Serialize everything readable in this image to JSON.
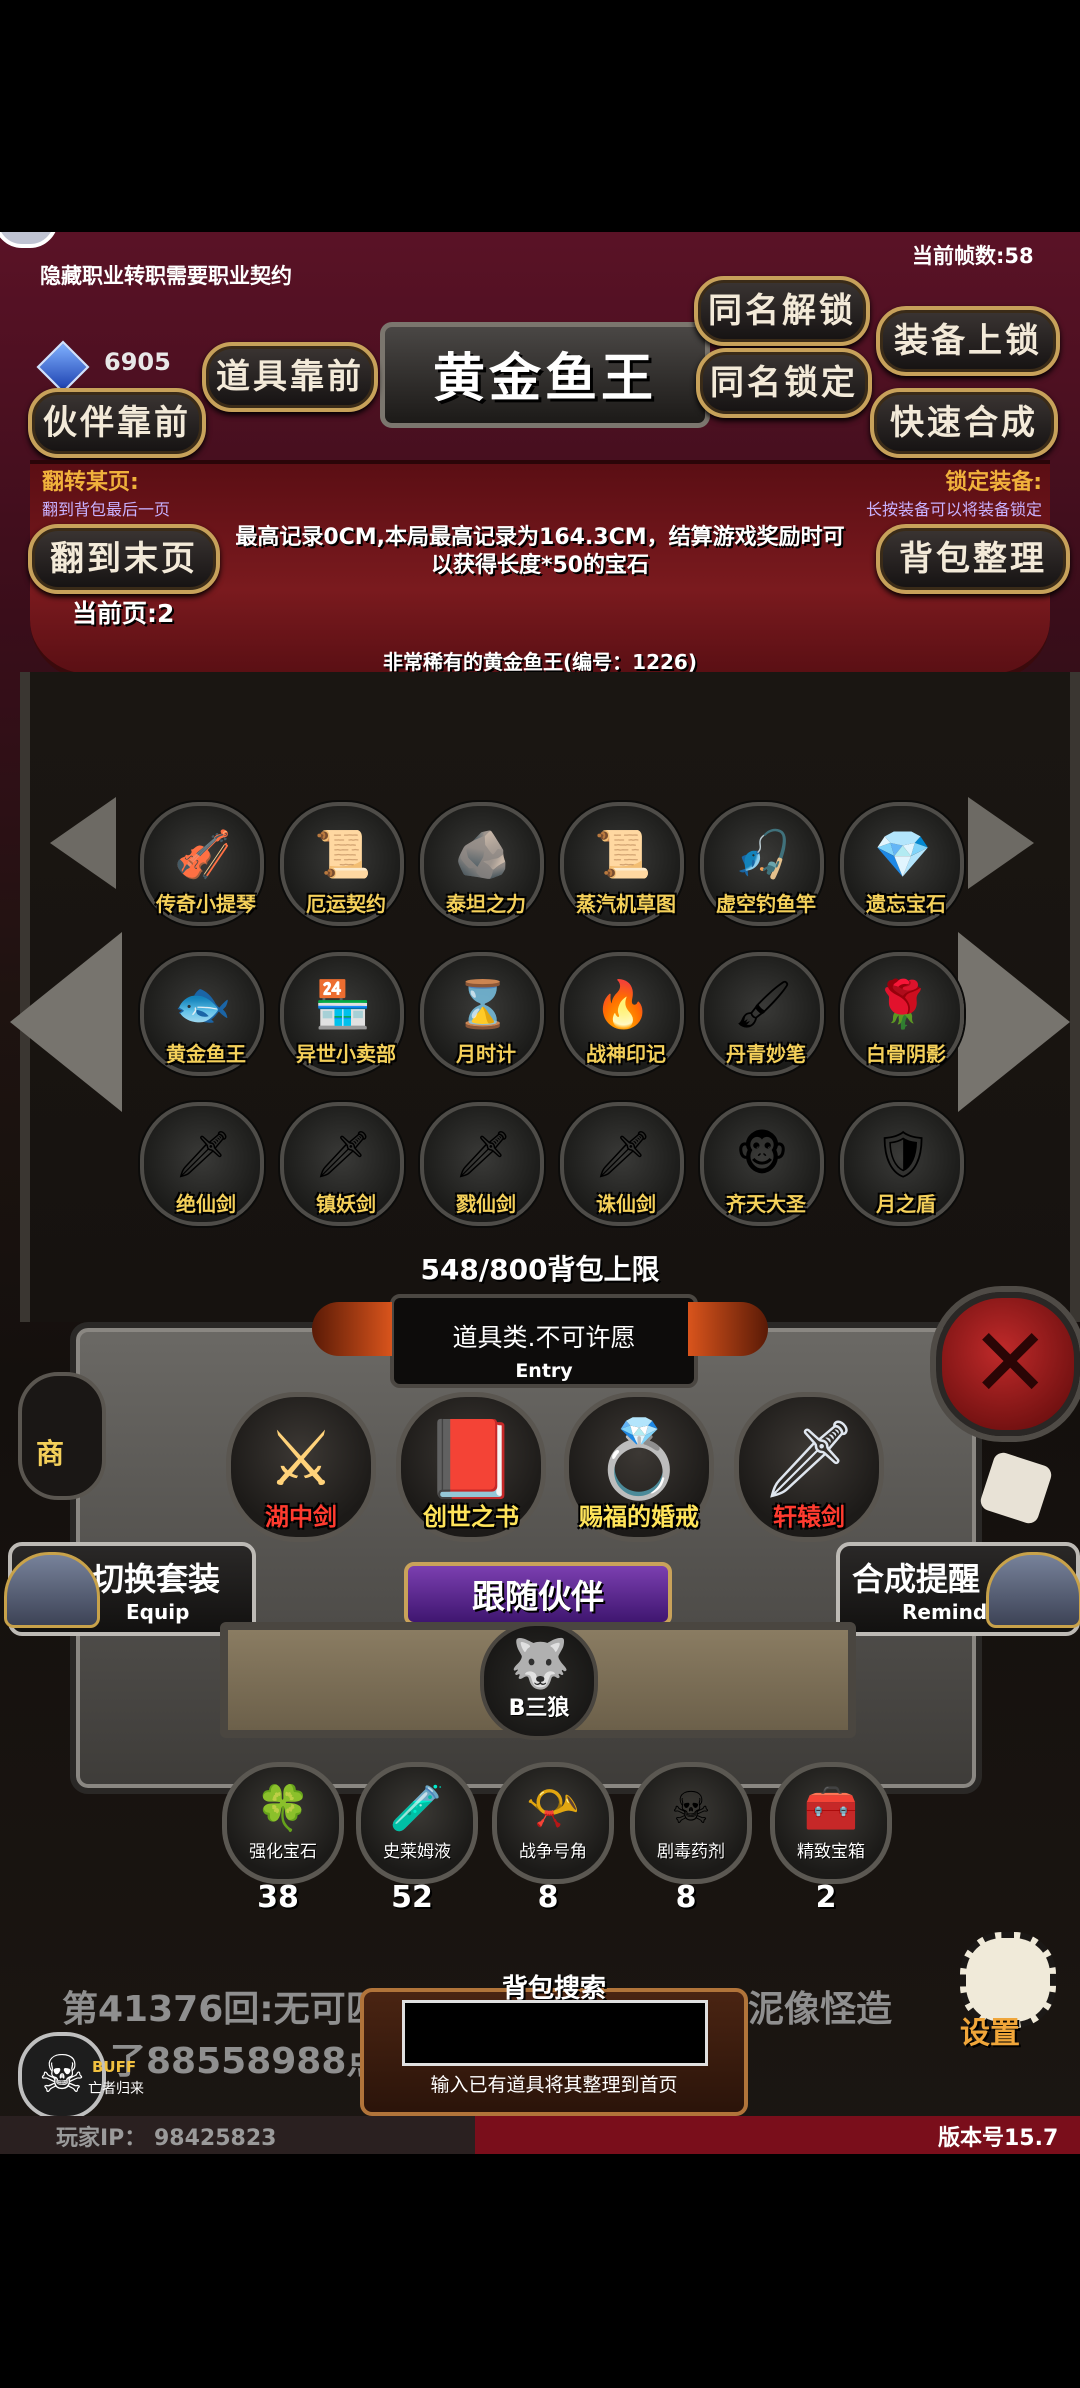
{
  "game": {
    "hidden_job_text": "隐藏职业转职需要职业契约",
    "fps_text": "当前帧数:58",
    "gem_count": "6905",
    "title": "黄金鱼王",
    "buttons": {
      "same_unlock": "同名解锁",
      "equip_lock": "装备上锁",
      "items_front": "道具靠前",
      "same_lock": "同名锁定",
      "partner_front": "伙伴靠前",
      "quick_combine": "快速合成",
      "goto_last": "翻到末页",
      "bag_sort": "背包整理"
    },
    "flip_page_title": "翻转某页:",
    "flip_page_desc": "翻到背包最后一页",
    "lock_equip_title": "锁定装备:",
    "lock_equip_desc": "长按装备可以将装备锁定",
    "record_text": "最高记录0CM,本局最高记录为164.3CM，结算游戏奖励时可以获得长度*50的宝石",
    "current_page": "当前页:2",
    "item_desc": "非常稀有的黄金鱼王(编号：1226)",
    "inventory": [
      {
        "label": "传奇小提琴",
        "icon": "🎻"
      },
      {
        "label": "厄运契约",
        "icon": "📜"
      },
      {
        "label": "泰坦之力",
        "icon": "🪨"
      },
      {
        "label": "蒸汽机草图",
        "icon": "📜"
      },
      {
        "label": "虚空钓鱼竿",
        "icon": "🎣"
      },
      {
        "label": "遗忘宝石",
        "icon": "💎"
      },
      {
        "label": "黄金鱼王",
        "icon": "🐟"
      },
      {
        "label": "异世小卖部",
        "icon": "🏪"
      },
      {
        "label": "月时计",
        "icon": "⌛"
      },
      {
        "label": "战神印记",
        "icon": "🔥"
      },
      {
        "label": "丹青妙笔",
        "icon": "🖌"
      },
      {
        "label": "白骨阴影",
        "icon": "🌹"
      },
      {
        "label": "绝仙剑",
        "icon": "🗡"
      },
      {
        "label": "镇妖剑",
        "icon": "🗡"
      },
      {
        "label": "戮仙剑",
        "icon": "🗡"
      },
      {
        "label": "诛仙剑",
        "icon": "🗡"
      },
      {
        "label": "齐天大圣",
        "icon": "🐵"
      },
      {
        "label": "月之盾",
        "icon": "🛡"
      }
    ],
    "bag_limit": "548/800背包上限",
    "entry_title": "道具类.不可许愿",
    "entry_sub": "Entry",
    "equipped": [
      {
        "label": "湖中剑",
        "icon": "⚔",
        "color": "#ff3b2f"
      },
      {
        "label": "创世之书",
        "icon": "📕",
        "color": "#ffe45a"
      },
      {
        "label": "赐福的婚戒",
        "icon": "💍",
        "color": "#ffe45a"
      },
      {
        "label": "轩辕剑",
        "icon": "🗡",
        "color": "#ff3b2f"
      }
    ],
    "switch_set": "切换套装",
    "switch_set_sub": "Equip",
    "combine_remind": "合成提醒",
    "combine_remind_sub": "Remind",
    "follow_partner": "跟随伙伴",
    "partner_name": "B三狼",
    "consumables": [
      {
        "label": "强化宝石",
        "count": "38",
        "icon": "🍀"
      },
      {
        "label": "史莱姆液",
        "count": "52",
        "icon": "🧪"
      },
      {
        "label": "战争号角",
        "count": "8",
        "icon": "📯"
      },
      {
        "label": "剧毒药剂",
        "count": "8",
        "icon": "☠"
      },
      {
        "label": "精致宝箱",
        "count": "2",
        "icon": "🧰"
      }
    ],
    "log_line1": "第41376回:无可匹",
    "log_line1_end": "泥像怪造",
    "log_line2": "了88558988点",
    "search_title": "背包搜索",
    "search_hint": "输入已有道具将其整理到首页",
    "buff_label": "BUFF",
    "buff_sub": "亡者归来",
    "player_ip": "玩家IP：  98425823",
    "version": "版本号15.7",
    "shop_label": "商",
    "settings_label": "设置"
  }
}
